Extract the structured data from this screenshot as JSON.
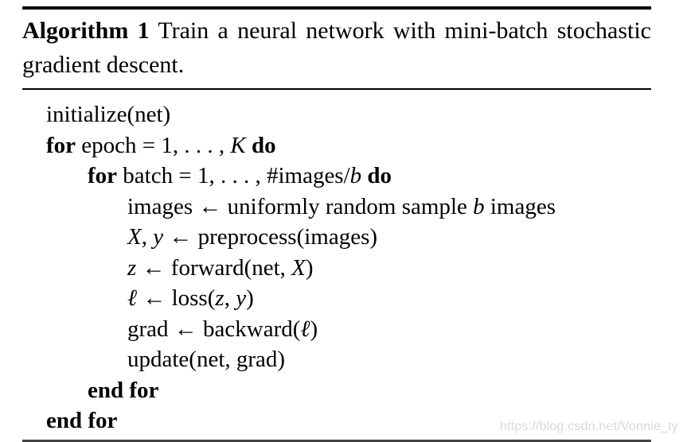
{
  "figure": {
    "label": "Algorithm 1",
    "caption": "Train a neural network with mini-batch stochastic gradient descent.",
    "lines": [
      {
        "indent": 1,
        "text": "initialize(net)"
      },
      {
        "indent": 1,
        "text": "for epoch = 1, . . . , K do"
      },
      {
        "indent": 2,
        "text": "for batch = 1, . . . , #images/b do"
      },
      {
        "indent": 3,
        "text": "images ← uniformly random sample b images"
      },
      {
        "indent": 3,
        "text": "X, y ← preprocess(images)"
      },
      {
        "indent": 3,
        "text": "z ← forward(net, X)"
      },
      {
        "indent": 3,
        "text": "ℓ ← loss(z, y)"
      },
      {
        "indent": 3,
        "text": "grad ← backward(ℓ)"
      },
      {
        "indent": 3,
        "text": "update(net, grad)"
      },
      {
        "indent": 2,
        "text": "end for"
      },
      {
        "indent": 1,
        "text": "end for"
      }
    ]
  },
  "watermark": {
    "text": "https://blog.csdn.net/Vonnie_ty"
  },
  "colors": {
    "text": "#000000",
    "rule": "#000000",
    "rule_bottom": "#444444",
    "watermark": "#d8d8d8",
    "background": "#ffffff"
  }
}
